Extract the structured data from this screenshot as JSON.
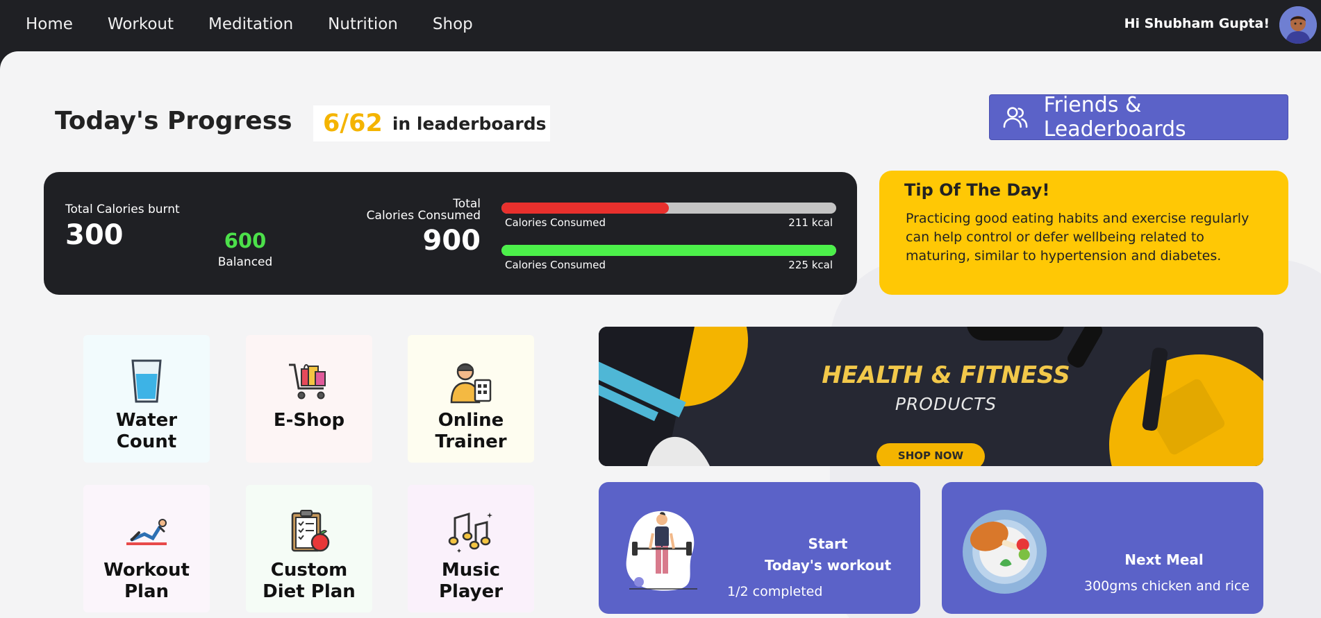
{
  "nav": {
    "items": [
      "Home",
      "Workout",
      "Meditation",
      "Nutrition",
      "Shop"
    ],
    "greeting": "Hi Shubham Gupta!"
  },
  "progress": {
    "title": "Today's Progress",
    "rank": "6/62",
    "rank_label": "in leaderboards",
    "friends_button": "Friends & Leaderboards"
  },
  "calories": {
    "burnt_label": "Total Calories burnt",
    "burnt_value": "300",
    "balanced_value": "600",
    "balanced_label": "Balanced",
    "consumed_label_1": "Total",
    "consumed_label_2": "Calories Consumed",
    "consumed_value": "900",
    "bars": [
      {
        "label": "Calories Consumed",
        "value": "211 kcal",
        "fraction": 0.5,
        "color": "#e8302d"
      },
      {
        "label": "Calories Consumed",
        "value": "225 kcal",
        "fraction": 1.0,
        "color": "#4cf04a"
      }
    ]
  },
  "tip": {
    "title": "Tip Of The Day!",
    "text": "Practicing good eating habits and exercise regularly can help control or defer wellbeing related to maturing, similar to hypertension and diabetes."
  },
  "tiles": [
    {
      "label": "Water Count",
      "icon": "water-glass-icon",
      "bg": "#f2fbfd"
    },
    {
      "label": "E-Shop",
      "icon": "shopping-cart-icon",
      "bg": "#fdf5f5"
    },
    {
      "label": "Online Trainer",
      "icon": "trainer-icon",
      "bg": "#fefdf0"
    },
    {
      "label": "Workout Plan",
      "icon": "workout-icon",
      "bg": "#fbf5fb"
    },
    {
      "label": "Custom Diet Plan",
      "icon": "diet-plan-icon",
      "bg": "#f5fcf6"
    },
    {
      "label": "Music Player",
      "icon": "music-notes-icon",
      "bg": "#faf1fb"
    }
  ],
  "banner": {
    "title": "HEALTH & FITNESS",
    "subtitle": "PRODUCTS",
    "button": "SHOP NOW"
  },
  "workout_card": {
    "title_1": "Start",
    "title_2": "Today's workout",
    "status": "1/2 completed"
  },
  "meal_card": {
    "title": "Next Meal",
    "meal": "300gms chicken and rice"
  },
  "colors": {
    "accent": "#5b62c8",
    "yellow": "#ffc805",
    "dark": "#1f2024",
    "green": "#4ce04a"
  }
}
